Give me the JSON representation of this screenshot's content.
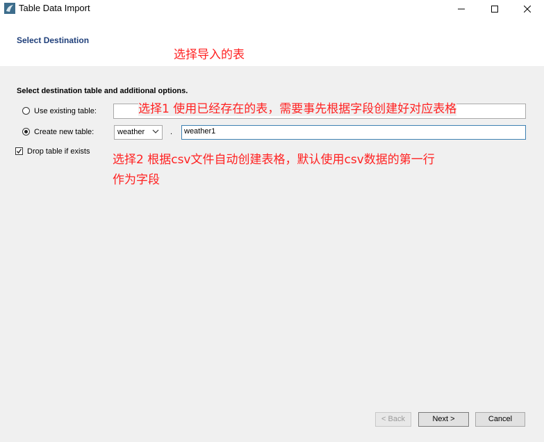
{
  "window": {
    "title": "Table Data Import",
    "icon": "mysql-workbench-icon"
  },
  "header": {
    "page_title": "Select Destination",
    "annotation_heading": "选择导入的表"
  },
  "form": {
    "instruction": "Select destination table and additional options.",
    "use_existing_label": "Use existing table:",
    "use_existing_value": "",
    "create_new_label": "Create new table:",
    "schema_value": "weather",
    "separator": ".",
    "new_table_value": "weather1",
    "drop_table_label": "Drop table if exists",
    "drop_table_checked": true,
    "selected_option": "create_new"
  },
  "annotations": {
    "option1": "选择1 使用已经存在的表，需要事先根据字段创建好对应表格",
    "option2_line1": "选择2 根据csv文件自动创建表格，默认使用csv数据的第一行",
    "option2_line2": "作为字段"
  },
  "footer": {
    "back_label": "< Back",
    "next_label": "Next >",
    "cancel_label": "Cancel"
  },
  "colors": {
    "annotation": "#ff2222",
    "title_blue": "#1f3f7a",
    "focus_border": "#3c7fb1"
  }
}
